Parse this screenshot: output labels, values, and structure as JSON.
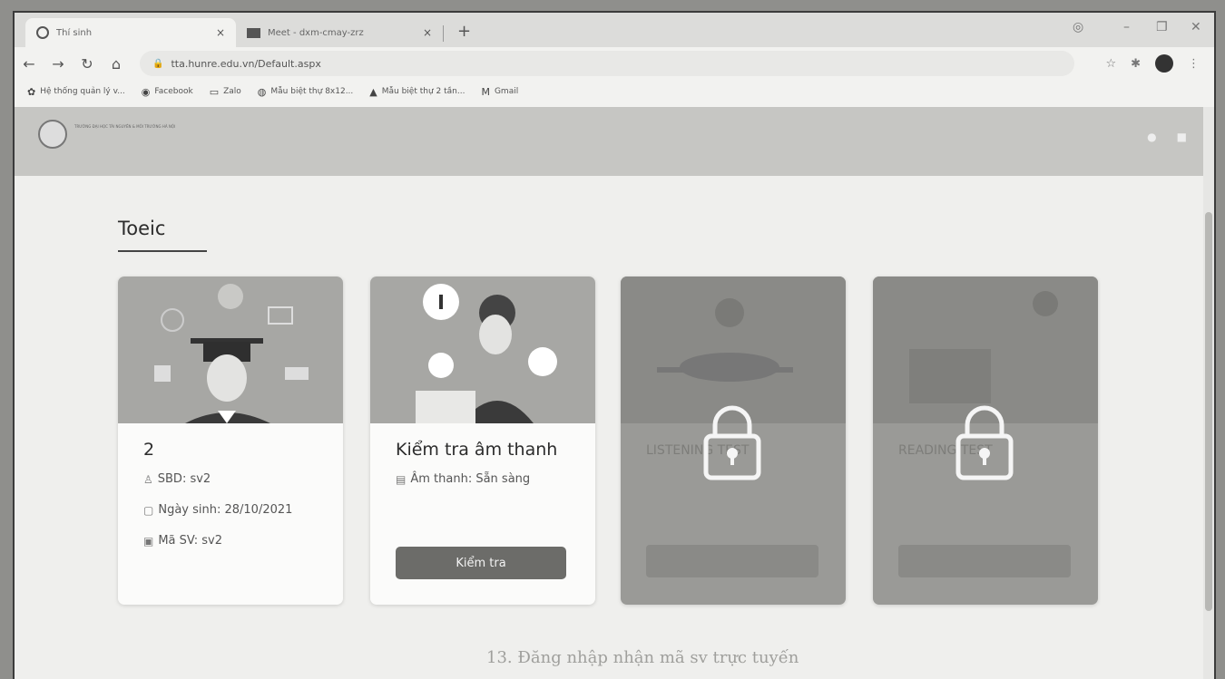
{
  "browser": {
    "tabs": [
      {
        "title": "Thí sinh",
        "close": "×"
      },
      {
        "title": "Meet - dxm-cmay-zrz",
        "close": "×"
      }
    ],
    "new_tab": "+",
    "url": "tta.hunre.edu.vn/Default.aspx",
    "bookmarks": [
      {
        "label": "Hệ thống quản lý v..."
      },
      {
        "label": "Facebook"
      },
      {
        "label": "Zalo"
      },
      {
        "label": "Mẫu biệt thự 8x12..."
      },
      {
        "label": "Mẫu biệt thự 2 tần..."
      },
      {
        "label": "Gmail"
      }
    ]
  },
  "site": {
    "header_logo_text": "TRƯỜNG ĐẠI HỌC TÀI NGUYÊN & MÔI TRƯỜNG HÀ NỘI"
  },
  "page": {
    "title": "Toeic",
    "cards": [
      {
        "title": "2",
        "sbd": "SBD: sv2",
        "dob": "Ngày sinh: 28/10/2021",
        "student_id": "Mã SV: sv2"
      },
      {
        "title": "Kiểm tra âm thanh",
        "status": "Âm thanh: Sẵn sàng",
        "button": "Kiểm tra"
      },
      {
        "ghost_title": "LISTENING TEST",
        "locked": true
      },
      {
        "ghost_title": "READING TEST",
        "locked": true
      }
    ]
  },
  "bottom_text": "13. Đăng nhập nhận mã sv trực tuyến"
}
